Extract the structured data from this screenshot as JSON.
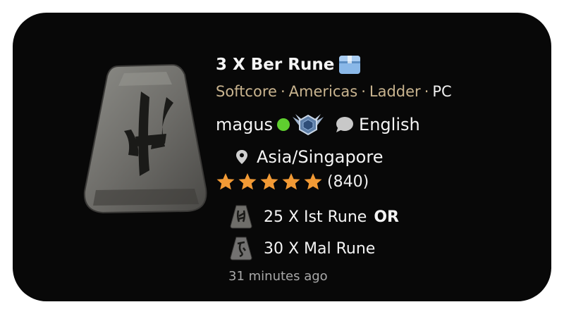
{
  "listing": {
    "title": "3 X Ber Rune",
    "tags": {
      "mode": "Softcore",
      "region": "Americas",
      "season": "Ladder",
      "platform": "PC"
    },
    "separator": "·",
    "seller": {
      "name": "magus",
      "status": "online",
      "language": "English",
      "location": "Asia/Singapore",
      "rating_stars": 5,
      "rating_count": "(840)"
    },
    "prices": [
      {
        "text": "25 X Ist Rune",
        "connector": "OR",
        "icon": "ist-rune-icon"
      },
      {
        "text": "30 X Mal Rune",
        "connector": "",
        "icon": "mal-rune-icon"
      }
    ],
    "posted": "31 minutes ago"
  },
  "colors": {
    "card_bg": "#080808",
    "tag_gold": "#c9b48f",
    "online_green": "#5fcf2f",
    "star_orange": "#f29a35",
    "box_blue": "#8ab8e8"
  },
  "icons": {
    "item": "ber-rune-icon",
    "box": "package-icon",
    "badge": "rank-badge-icon",
    "chat": "chat-bubble-icon",
    "location": "map-pin-icon",
    "star": "star-icon"
  }
}
